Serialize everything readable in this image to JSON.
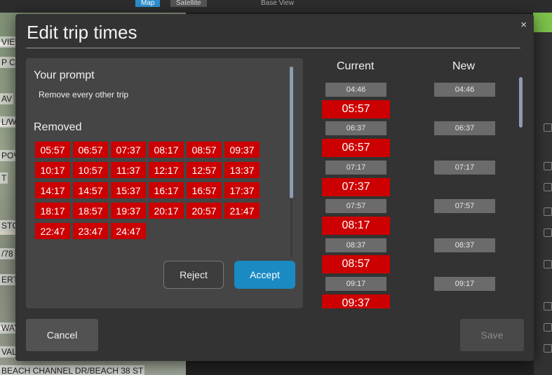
{
  "background": {
    "map_tab": "Map",
    "satellite_tab": "Satellite",
    "base_view": "Base View",
    "street_labels": [
      "VIE",
      "P CI",
      "AV",
      "L/W",
      "POV",
      "T",
      "STC",
      "/78",
      "ERT",
      "WAY",
      "VALK",
      "BEACH CHANNEL DR/BEACH 38 ST"
    ]
  },
  "modal": {
    "title": "Edit trip times",
    "close_label": "×",
    "prompt_heading": "Your prompt",
    "prompt_text": "Remove every other trip",
    "removed_heading": "Removed",
    "removed_times": [
      "05:57",
      "06:57",
      "07:37",
      "08:17",
      "08:57",
      "09:37",
      "10:17",
      "10:57",
      "11:37",
      "12:17",
      "12:57",
      "13:37",
      "14:17",
      "14:57",
      "15:37",
      "16:17",
      "16:57",
      "17:37",
      "18:17",
      "18:57",
      "19:37",
      "20:17",
      "20:57",
      "21:47",
      "22:47",
      "23:47",
      "24:47"
    ],
    "reject_label": "Reject",
    "accept_label": "Accept",
    "current_heading": "Current",
    "new_heading": "New",
    "rows": [
      {
        "current": "04:46",
        "removed": false,
        "new": "04:46"
      },
      {
        "current": "05:57",
        "removed": true,
        "new": ""
      },
      {
        "current": "06:37",
        "removed": false,
        "new": "06:37"
      },
      {
        "current": "06:57",
        "removed": true,
        "new": ""
      },
      {
        "current": "07:17",
        "removed": false,
        "new": "07:17"
      },
      {
        "current": "07:37",
        "removed": true,
        "new": ""
      },
      {
        "current": "07:57",
        "removed": false,
        "new": "07:57"
      },
      {
        "current": "08:17",
        "removed": true,
        "new": ""
      },
      {
        "current": "08:37",
        "removed": false,
        "new": "08:37"
      },
      {
        "current": "08:57",
        "removed": true,
        "new": ""
      },
      {
        "current": "09:17",
        "removed": false,
        "new": "09:17"
      },
      {
        "current": "09:37",
        "removed": true,
        "new": ""
      }
    ],
    "cancel_label": "Cancel",
    "save_label": "Save",
    "colors": {
      "removed": "#cc0000",
      "kept": "#6b6b6b",
      "accent": "#1a8ac3",
      "modal_bg": "#333333"
    }
  }
}
